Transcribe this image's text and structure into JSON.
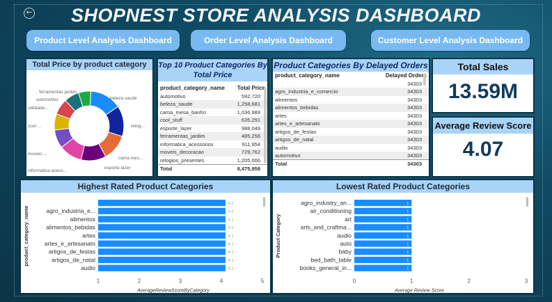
{
  "header": {
    "title": "SHOPNEST STORE ANALYSIS DASHBOARD",
    "back_icon": "back-arrow-icon"
  },
  "nav": [
    {
      "label": "Product Level Analysis Dashboard"
    },
    {
      "label": "Order Level Analysis Dashboard"
    },
    {
      "label": "Customer Level Analysis Dashboard"
    }
  ],
  "kpis": {
    "total_sales": {
      "label": "Total Sales",
      "value": "13.59M"
    },
    "avg_review": {
      "label": "Average Review Score",
      "value": "4.07"
    }
  },
  "top10": {
    "title": "Top 10 Product Categories By Total Price",
    "columns": [
      "product_category_name",
      "Total Price"
    ],
    "rows": [
      [
        "automotivo",
        "592,720"
      ],
      [
        "beleza_saude",
        "1,258,681"
      ],
      [
        "cama_mesa_banho",
        "1,036,989"
      ],
      [
        "cool_stuff",
        "635,291"
      ],
      [
        "esporte_lazer",
        "988,049"
      ],
      [
        "ferramentas_jardim",
        "485,256"
      ],
      [
        "informatica_acessorios",
        "911,954"
      ],
      [
        "moveis_decoracao",
        "729,762"
      ],
      [
        "relogios_presentes",
        "1,205,006"
      ]
    ],
    "total_label": "Total",
    "total": "8,475,958"
  },
  "delayed": {
    "title": "Product Categories By Delayed Orders",
    "columns": [
      "product_category_name",
      "Delayed Orders"
    ],
    "rows": [
      [
        "",
        "34303"
      ],
      [
        "agro_industria_e_comercio",
        "34303"
      ],
      [
        "alimentos",
        "34303"
      ],
      [
        "alimentos_bebidas",
        "34303"
      ],
      [
        "artes",
        "34303"
      ],
      [
        "artes_e_artesanato",
        "34303"
      ],
      [
        "artigos_de_festas",
        "34303"
      ],
      [
        "artigos_de_natal",
        "34303"
      ],
      [
        "audio",
        "34303"
      ],
      [
        "automotivo",
        "34303"
      ]
    ],
    "total_label": "Total",
    "total": "34303"
  },
  "chart_data": [
    {
      "type": "pie",
      "donut": true,
      "title": "Total Price by product category",
      "labels": [
        "beleza saude",
        "relog...",
        "cama mes...",
        "esporte lazer",
        "informatica acess...",
        "moveis ...",
        "cool ...",
        "utilidade...",
        "automotivo",
        "ferramentas jardim"
      ],
      "values": [
        1258681,
        1205006,
        1036989,
        988049,
        911954,
        729762,
        635291,
        632250,
        592720,
        485256
      ],
      "colors": [
        "#1a8cff",
        "#12239e",
        "#e66c37",
        "#6b007b",
        "#e044a7",
        "#744ec2",
        "#d9b300",
        "#d64550",
        "#197278",
        "#1aab40"
      ]
    },
    {
      "type": "bar",
      "orientation": "horizontal",
      "title": "Highest Rated Product Categories",
      "xlabel": "AverageReviewScoreByCategory",
      "ylabel": "product_category_name",
      "categories": [
        "",
        "agro_industria_e...",
        "alimentos",
        "alimentos_bebidas",
        "artes",
        "artes_e_artesanato",
        "artigos_de_festas",
        "artigos_de_natal",
        "audio"
      ],
      "values": [
        4.1,
        4.1,
        4.1,
        4.1,
        4.1,
        4.1,
        4.1,
        4.1,
        4.1
      ],
      "xlim": [
        1,
        5
      ],
      "xticks": [
        "1",
        "2",
        "3",
        "4",
        "5"
      ],
      "color": "#1a8cff"
    },
    {
      "type": "bar",
      "orientation": "horizontal",
      "title": "Lowest Rated Product Categories",
      "xlabel": "Average Review Score",
      "ylabel": "Product Category",
      "categories": [
        "agro_industry_an...",
        "air_conditioning",
        "art",
        "arts_and_craftma...",
        "audio",
        "auto",
        "baby",
        "bed_bath_table",
        "books_general_in..."
      ],
      "values": [
        1,
        1,
        1,
        1,
        1,
        1,
        1,
        1,
        1
      ],
      "xlim": [
        0,
        3
      ],
      "xticks": [
        "0",
        "1",
        "2",
        "3"
      ],
      "color": "#1a8cff"
    }
  ]
}
